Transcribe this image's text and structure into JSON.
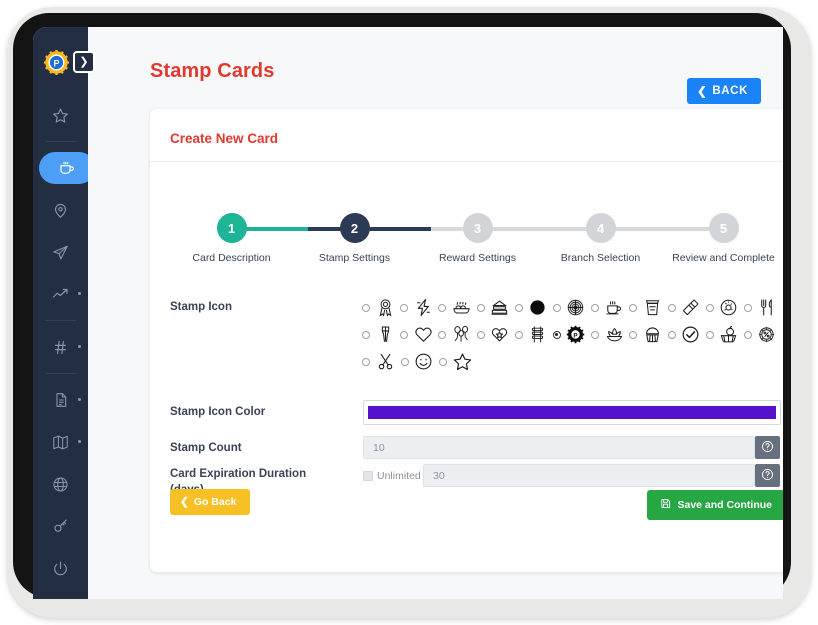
{
  "brand": {
    "logo_icon": "p-badge-logo",
    "expand_icon": "chevron-right-icon"
  },
  "sidebar": {
    "items": [
      {
        "icon": "star-icon",
        "name": "favorites",
        "active": false,
        "dot": false,
        "sep_after": true
      },
      {
        "icon": "coffee-cup-icon",
        "name": "stamp-cards",
        "active": true,
        "dot": false,
        "sep_after": false
      },
      {
        "icon": "location-pin-icon",
        "name": "branches",
        "active": false,
        "dot": false,
        "sep_after": false
      },
      {
        "icon": "paper-plane-icon",
        "name": "campaigns",
        "active": false,
        "dot": false,
        "sep_after": false
      },
      {
        "icon": "trending-up-icon",
        "name": "reports",
        "active": false,
        "dot": true,
        "sep_after": true
      },
      {
        "icon": "hash-icon",
        "name": "tags",
        "active": false,
        "dot": true,
        "sep_after": true
      },
      {
        "icon": "document-icon",
        "name": "documents",
        "active": false,
        "dot": true,
        "sep_after": false
      },
      {
        "icon": "map-icon",
        "name": "map",
        "active": false,
        "dot": true,
        "sep_after": false
      },
      {
        "icon": "globe-icon",
        "name": "language",
        "active": false,
        "dot": false,
        "sep_after": false
      },
      {
        "icon": "key-icon",
        "name": "permissions",
        "active": false,
        "dot": false,
        "sep_after": false
      },
      {
        "icon": "power-icon",
        "name": "logout",
        "active": false,
        "dot": false,
        "sep_after": false
      }
    ]
  },
  "header": {
    "title": "Stamp Cards",
    "back_label": "BACK",
    "back_icon": "chevron-left-icon",
    "back_color": "#1a83f7",
    "title_color": "#e0392f"
  },
  "panel": {
    "title": "Create New Card"
  },
  "stepper": {
    "current": 2,
    "active_color": "#1eb596",
    "current_color": "#2c3a55",
    "inactive_color": "#c9cbce",
    "steps": [
      {
        "number": "1",
        "label": "Card Description",
        "state": "done"
      },
      {
        "number": "2",
        "label": "Stamp Settings",
        "state": "current"
      },
      {
        "number": "3",
        "label": "Reward Settings",
        "state": "todo"
      },
      {
        "number": "4",
        "label": "Branch Selection",
        "state": "todo"
      },
      {
        "number": "5",
        "label": "Review and Complete",
        "state": "todo"
      }
    ]
  },
  "form": {
    "stamp_icon": {
      "label": "Stamp Icon",
      "selected_index": 16,
      "icons": [
        "award-ribbon-icon",
        "lightning-bolt-icon",
        "bread-loaf-icon",
        "layer-cake-icon",
        "filled-circle-icon",
        "dartboard-icon",
        "coffee-cup-steam-icon",
        "togo-cup-icon",
        "comb-icon",
        "donut-icon",
        "fork-knife-icon",
        "clothespin-icon",
        "heart-icon",
        "balloons-icon",
        "heart-star-icon",
        "skewer-icon",
        "p-logo-icon",
        "lotus-icon",
        "cupcake-icon",
        "check-circle-icon",
        "fruit-basket-icon",
        "percent-badge-icon",
        "scissors-icon",
        "smiley-icon",
        "star-outline-icon"
      ]
    },
    "stamp_icon_color": {
      "label": "Stamp Icon Color",
      "value": "#5511cc"
    },
    "stamp_count": {
      "label": "Stamp Count",
      "placeholder": "10",
      "help_icon": "question-mark-icon"
    },
    "card_expiration": {
      "label": "Card Expiration Duration (days)",
      "label_line1": "Card Expiration Duration",
      "label_line2": "(days)",
      "unlimited_label": "Unlimited",
      "unlimited_checked": false,
      "placeholder": "30",
      "help_icon": "question-mark-icon"
    }
  },
  "footer": {
    "go_back": {
      "label": "Go Back",
      "icon": "chevron-left-icon",
      "color": "#f7c024"
    },
    "save_continue": {
      "label": "Save and Continue",
      "icon": "save-disk-icon",
      "color": "#27a744"
    }
  }
}
